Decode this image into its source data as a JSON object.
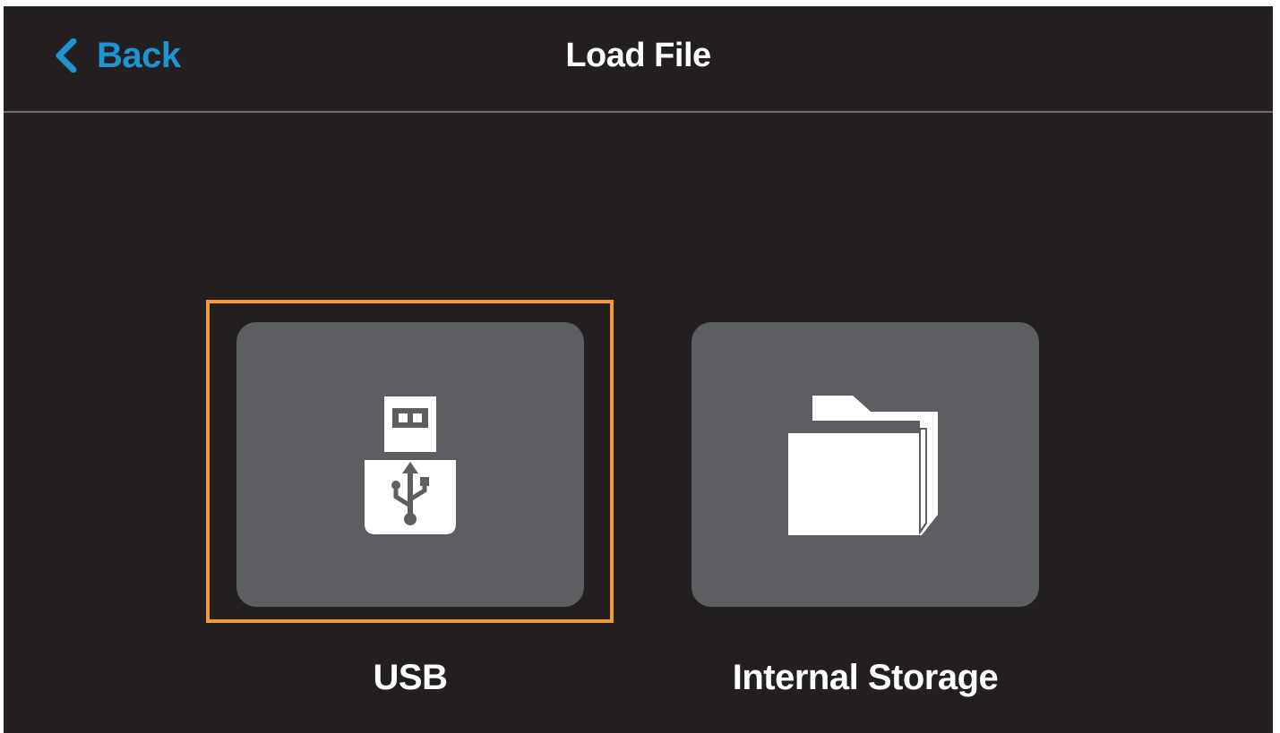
{
  "header": {
    "back_label": "Back",
    "title": "Load File"
  },
  "options": [
    {
      "label": "USB",
      "icon": "usb-drive-icon",
      "selected": true
    },
    {
      "label": "Internal Storage",
      "icon": "folder-icon",
      "selected": false
    }
  ],
  "colors": {
    "background": "#231f20",
    "accent": "#1e94d2",
    "tile": "#5d5e62",
    "selection": "#f29a3a",
    "divider": "#6d6d70"
  }
}
